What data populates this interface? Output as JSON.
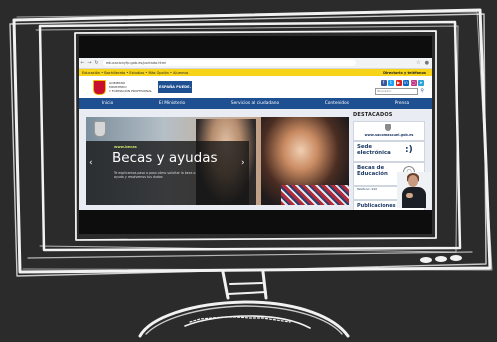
{
  "browser": {
    "url": "educacionyfp.gob.es/portada.html",
    "nav": [
      "back-arrow",
      "forward-arrow",
      "reload"
    ]
  },
  "site": {
    "breadcrumb": "Educación  •  Bachillerato  •  Estudios  •  Más Opción  •  Alumnos",
    "contact_link": "Directorio y teléfonos",
    "ministry_lines": [
      "GOBIERNO",
      "DE ESPAÑA",
      "MINISTERIO",
      "DE EDUCACIÓN",
      "Y FORMACIÓN PROFESIONAL"
    ],
    "brand_logo": "ESPAÑA PUEDE.",
    "search_placeholder": "Buscador",
    "social_icons": [
      "facebook",
      "twitter",
      "youtube",
      "linkedin",
      "instagram",
      "telegram"
    ],
    "menu": [
      "Inicio",
      "El Ministerio",
      "Servicios al ciudadano",
      "Contenidos",
      "Prensa"
    ]
  },
  "hero": {
    "tag": "www.becas",
    "title": "Becas y ayudas",
    "subtitle": "Te explicamos paso a paso cómo solicitar la beca o ayuda y resolvemos tus dudas"
  },
  "sidebar": {
    "title": "DESTACADOS",
    "site_url": "www.sacomascuel.gob.es",
    "sede": "Sede electrónica",
    "becas": "Becas de Educación",
    "phone_label": "Teléfono: 910",
    "publicaciones": "Publicaciones"
  },
  "colors": {
    "accent_yellow": "#f7d417",
    "menu_blue": "#1d4f91",
    "background": "#2b2b2b"
  }
}
